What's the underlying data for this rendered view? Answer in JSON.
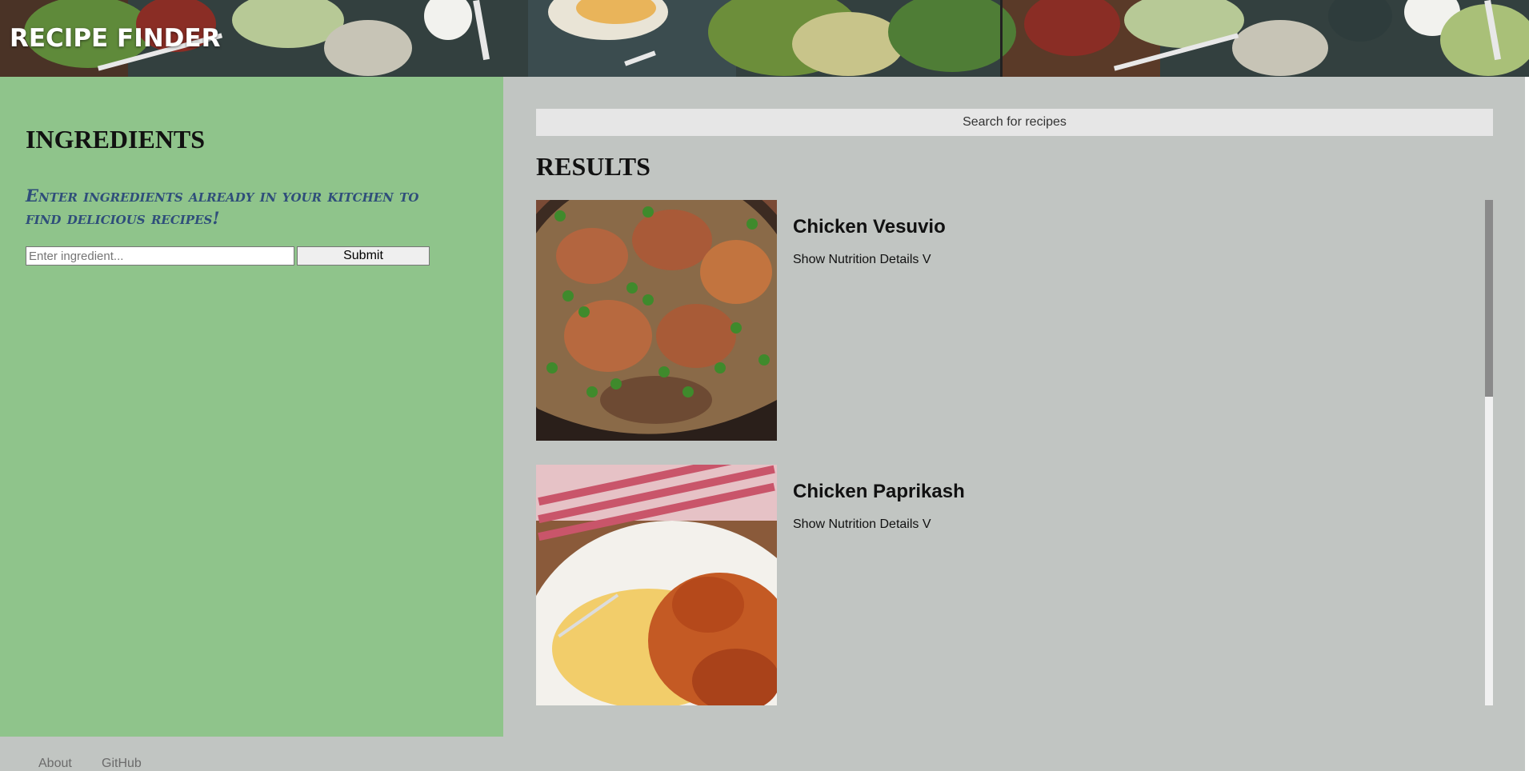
{
  "header": {
    "brand": "RECIPE FINDER"
  },
  "sidebar": {
    "title": "INGREDIENTS",
    "tagline": "Enter ingredients already in your kitchen to find delicious recipes!",
    "input_placeholder": "Enter ingredient...",
    "submit_label": "Submit"
  },
  "main": {
    "search_placeholder": "Search for recipes",
    "results_title": "RESULTS",
    "results": [
      {
        "name": "Chicken Vesuvio",
        "toggle": "Show Nutrition Details V"
      },
      {
        "name": "Chicken Paprikash",
        "toggle": "Show Nutrition Details V"
      }
    ]
  },
  "footer": {
    "links": [
      "About",
      "GitHub"
    ]
  },
  "colors": {
    "sidebar_bg": "#8fc48b",
    "main_bg": "#c1c5c2",
    "tagline": "#2f4e7a"
  }
}
